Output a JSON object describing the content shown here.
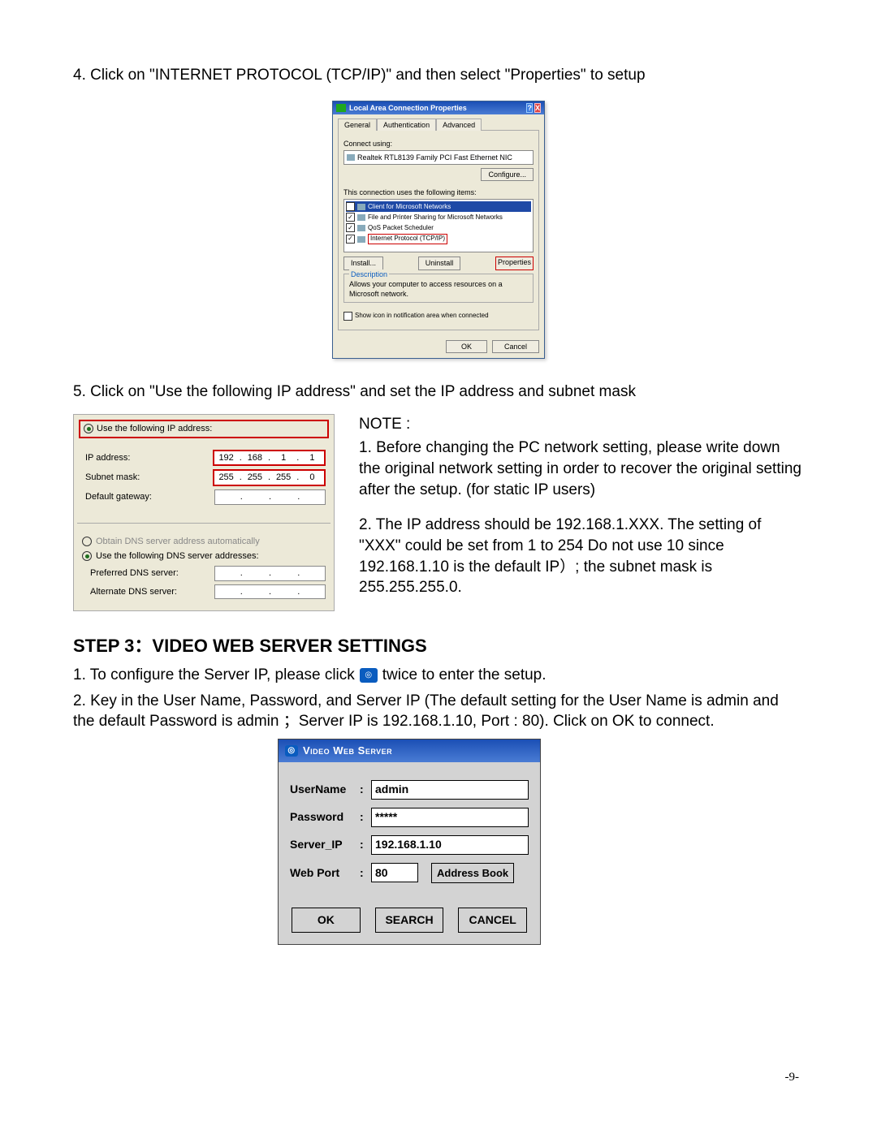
{
  "step4": "4. Click on \"INTERNET PROTOCOL (TCP/IP)\" and then select \"Properties\" to setup",
  "dlg1": {
    "title": "Local Area Connection Properties",
    "tabs": {
      "t1": "General",
      "t2": "Authentication",
      "t3": "Advanced"
    },
    "connect_label": "Connect using:",
    "nic": "Realtek RTL8139 Family PCI Fast Ethernet NIC",
    "configure": "Configure...",
    "uses": "This connection uses the following items:",
    "items": {
      "i1": "Client for Microsoft Networks",
      "i2": "File and Printer Sharing for Microsoft Networks",
      "i3": "QoS Packet Scheduler",
      "i4": "Internet Protocol (TCP/IP)"
    },
    "install": "Install...",
    "uninstall": "Uninstall",
    "properties": "Properties",
    "desc_h": "Description",
    "desc_t": "Allows your computer to access resources on a Microsoft network.",
    "show": "Show icon in notification area when connected",
    "ok": "OK",
    "cancel": "Cancel"
  },
  "step5": "5. Click on \"Use the following IP address\" and set the IP address and subnet mask",
  "ipbox": {
    "usefollow": "Use the following IP address:",
    "ip_l": "IP address:",
    "ip": {
      "a": "192",
      "b": "168",
      "c": "1",
      "d": "1"
    },
    "mask_l": "Subnet mask:",
    "mask": {
      "a": "255",
      "b": "255",
      "c": "255",
      "d": "0"
    },
    "gw_l": "Default gateway:",
    "dns_auto": "Obtain DNS server address automatically",
    "dns_use": "Use the following DNS server addresses:",
    "pref": "Preferred DNS server:",
    "alt": "Alternate DNS server:"
  },
  "notes": {
    "h": "NOTE :",
    "n1": "1. Before changing the PC network setting, please write down the original network setting in order to recover the original setting after the setup. (for static IP users)",
    "n2": "2. The IP address should be 192.168.1.XXX. The setting of \"XXX\" could be set from 1 to 254 Do not use 10 since 192.168.1.10 is the default IP）; the subnet mask is 255.255.255.0."
  },
  "step3h": "STEP 3：VIDEO WEB SERVER SETTINGS",
  "s3": {
    "l1a": "1. To configure the Server IP, please click",
    "l1b": "twice to enter the setup.",
    "l2": "2. Key in the User Name, Password, and Server IP (The default setting for the User Name is admin and the default Password is admin ；Server IP is 192.168.1.10, Port : 80). Click on OK to connect."
  },
  "vws": {
    "title": "Video Web Server",
    "user_l": "UserName",
    "user_v": "admin",
    "pass_l": "Password",
    "pass_v": "*****",
    "ip_l": "Server_IP",
    "ip_v": "192.168.1.10",
    "port_l": "Web Port",
    "port_v": "80",
    "ab": "Address Book",
    "ok": "OK",
    "search": "SEARCH",
    "cancel": "CANCEL"
  },
  "pageno": "-9-"
}
